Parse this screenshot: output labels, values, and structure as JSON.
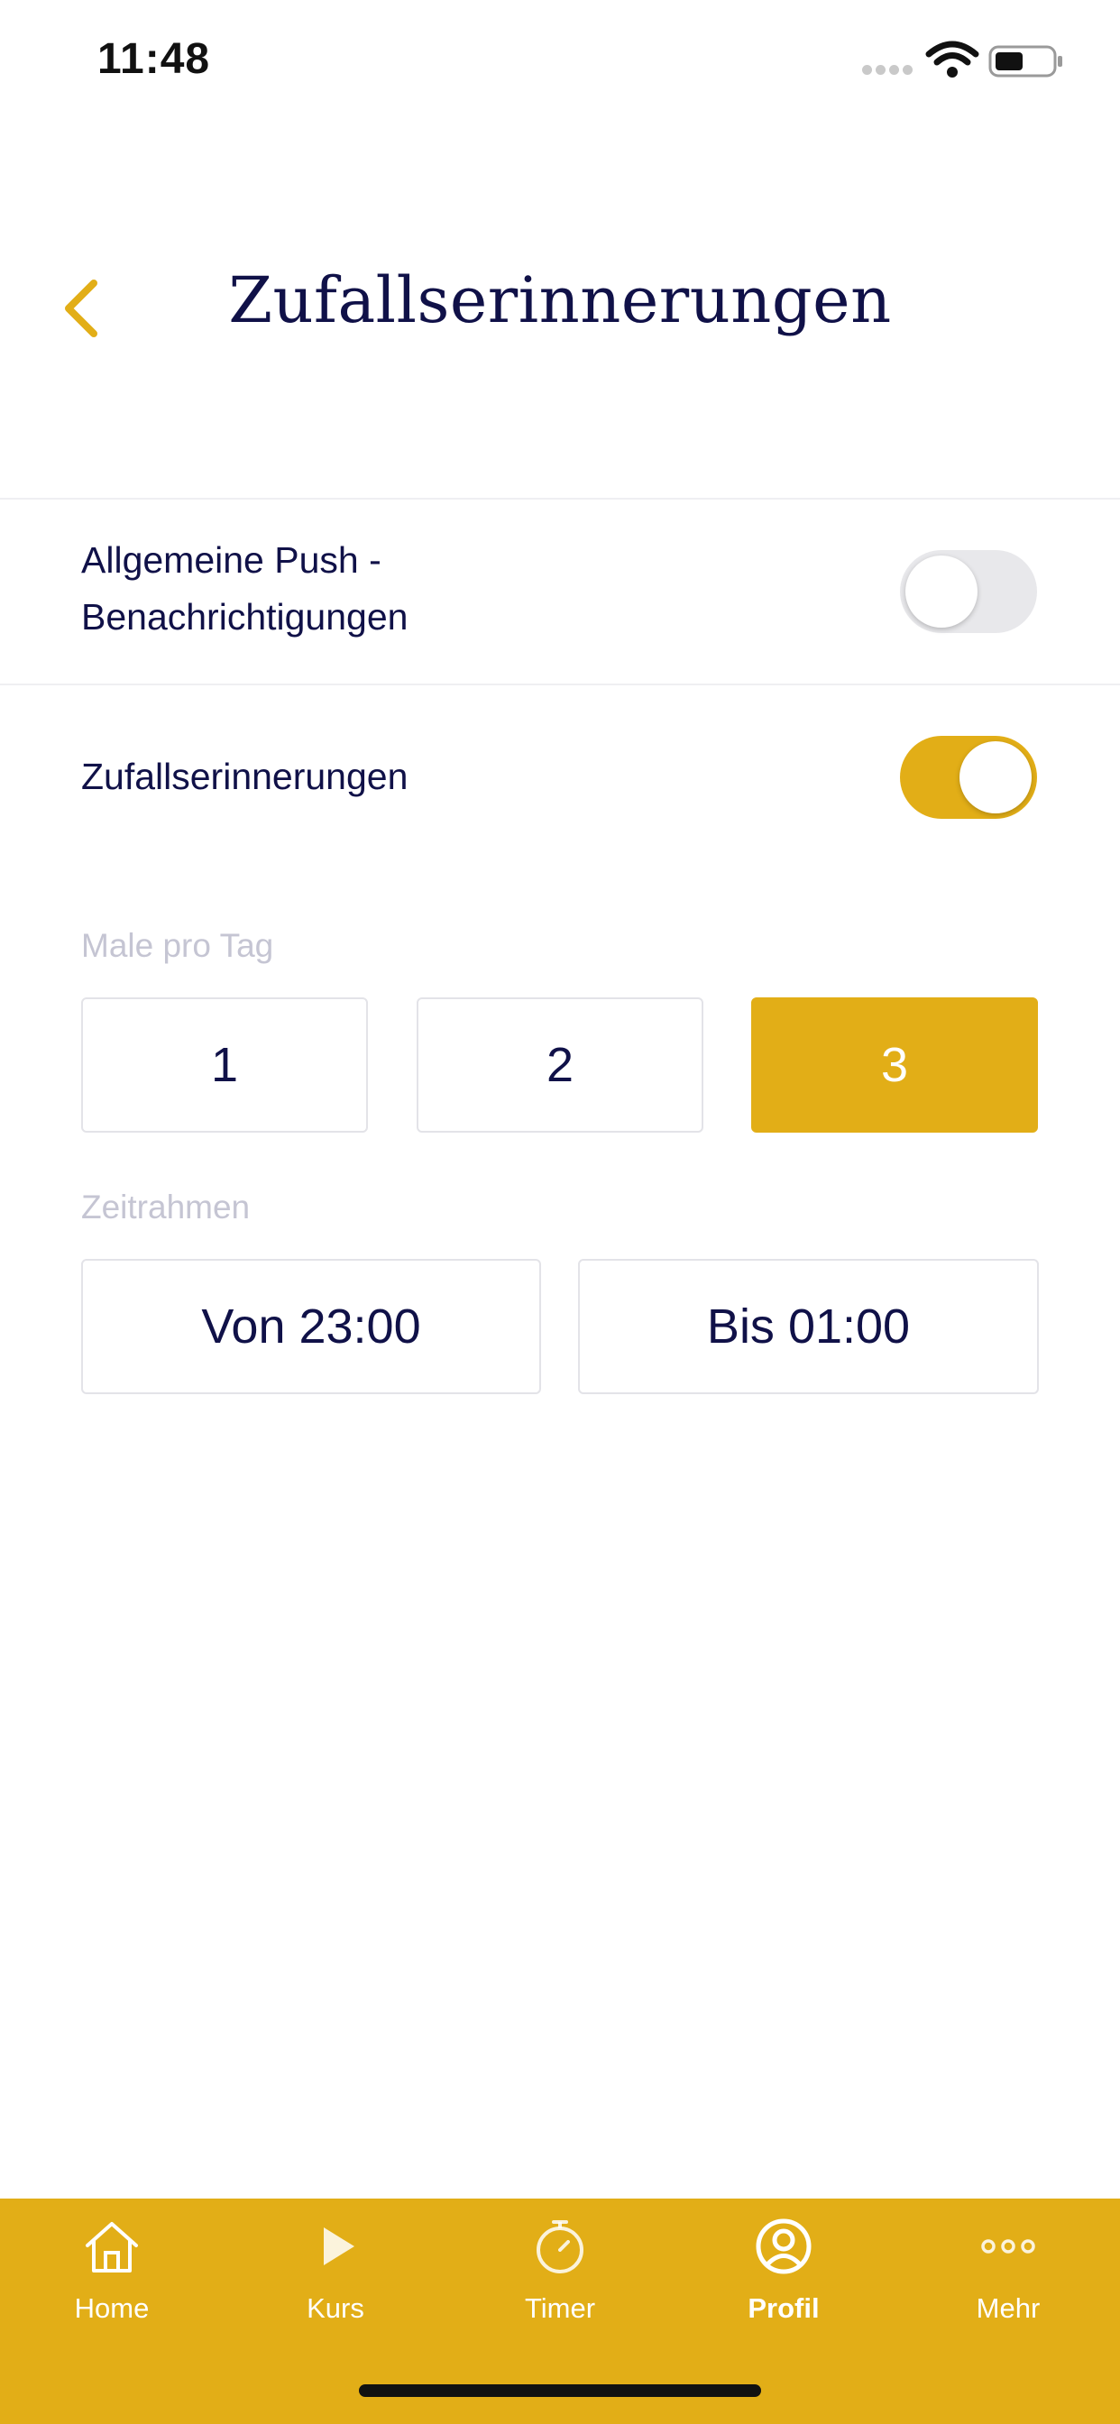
{
  "status_bar": {
    "time": "11:48"
  },
  "header": {
    "title": "Zufallserinnerungen"
  },
  "settings": {
    "push": {
      "label_line1": "Allgemeine Push -",
      "label_line2": "Benachrichtigungen",
      "enabled": false
    },
    "random": {
      "label": "Zufallserinnerungen",
      "enabled": true
    }
  },
  "times_per_day": {
    "label": "Male pro Tag",
    "options": [
      "1",
      "2",
      "3"
    ],
    "selected": "3"
  },
  "timeframe": {
    "label": "Zeitrahmen",
    "from": "Von 23:00",
    "to": "Bis 01:00"
  },
  "tabbar": {
    "items": [
      {
        "label": "Home",
        "icon": "home-icon"
      },
      {
        "label": "Kurs",
        "icon": "play-icon"
      },
      {
        "label": "Timer",
        "icon": "stopwatch-icon"
      },
      {
        "label": "Profil",
        "icon": "profile-icon",
        "active": true
      },
      {
        "label": "Mehr",
        "icon": "more-icon"
      }
    ]
  },
  "colors": {
    "accent": "#e2ae17",
    "navy": "#101148",
    "muted": "#c5c5d3"
  }
}
